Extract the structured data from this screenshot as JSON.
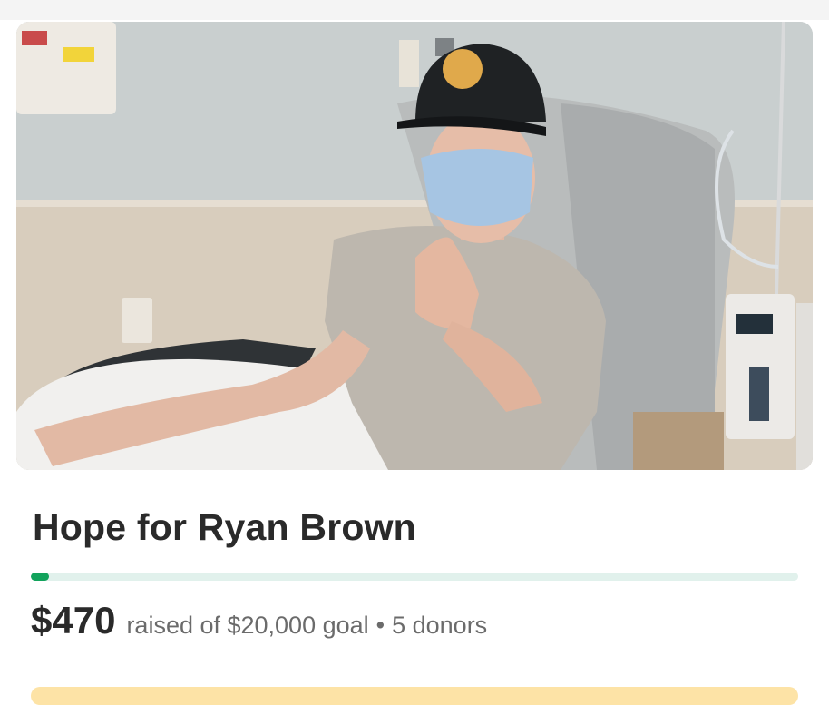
{
  "campaign": {
    "photo_alt": "Young man in a black cap and surgical mask giving a thumbs up in a hospital infusion chair",
    "title": "Hope for Ryan Brown",
    "raised_amount": "$470",
    "raised_of_text": "raised of $20,000 goal",
    "separator": "•",
    "donors_text": "5 donors",
    "progress_fraction": 0.0235
  },
  "colors": {
    "progress_fill": "#12a35c",
    "progress_track": "#e1f1ec",
    "banner": "#fde3a6"
  }
}
